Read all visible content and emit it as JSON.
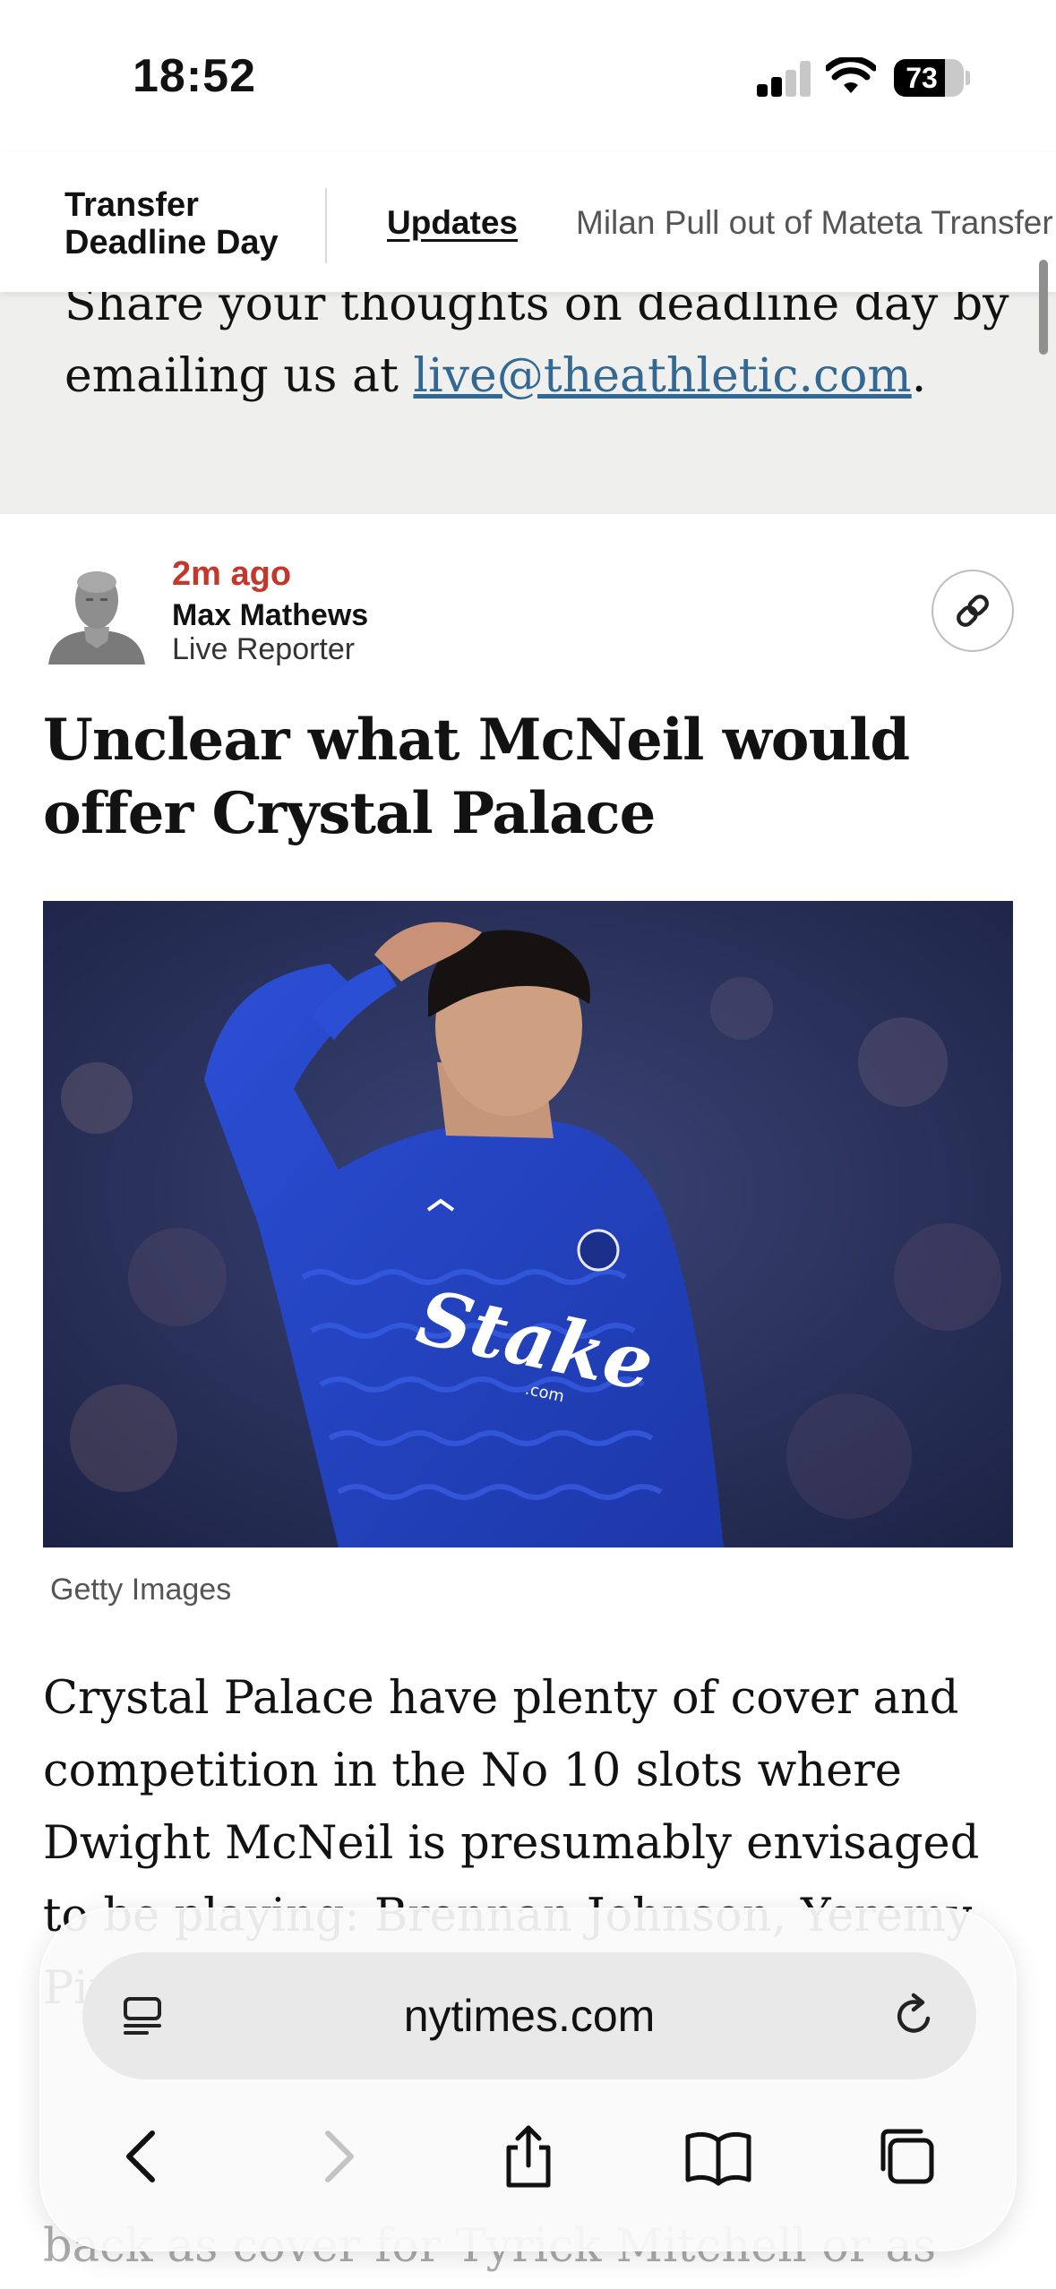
{
  "status_bar": {
    "time": "18:52",
    "battery": "73"
  },
  "live_header": {
    "title": "Transfer Deadline Day",
    "tabs": [
      {
        "label": "Updates",
        "active": true
      },
      {
        "label": "Milan Pull out of Mateta Transfer",
        "active": false
      }
    ]
  },
  "callout": {
    "text": "Share your thoughts on deadline day by emailing us at ",
    "email": "live@theathletic.com",
    "suffix": "."
  },
  "post": {
    "time": "2m ago",
    "author": "Max Mathews",
    "role": "Live Reporter",
    "headline": "Unclear what McNeil would offer Crystal Palace",
    "image_credit": "Getty Images",
    "image_shirt_text": "Stake",
    "image_shirt_subtext": ".com",
    "body": "Crystal Palace have plenty of cover and competition in the No 10 slots where Dwight McNeil is presumably envisaged to be playing: Brennan Johnson, Yeremy Pino",
    "body_continued": "back as cover for Tyrick Mitchell or as"
  },
  "browser": {
    "url": "nytimes.com",
    "icons": [
      "reader-icon",
      "reload-icon",
      "back-icon",
      "forward-icon",
      "share-icon",
      "bookmarks-icon",
      "tabs-icon"
    ]
  },
  "colors": {
    "timestamp": "#c5372a",
    "link": "#326891",
    "callout_bg": "#efefed"
  }
}
